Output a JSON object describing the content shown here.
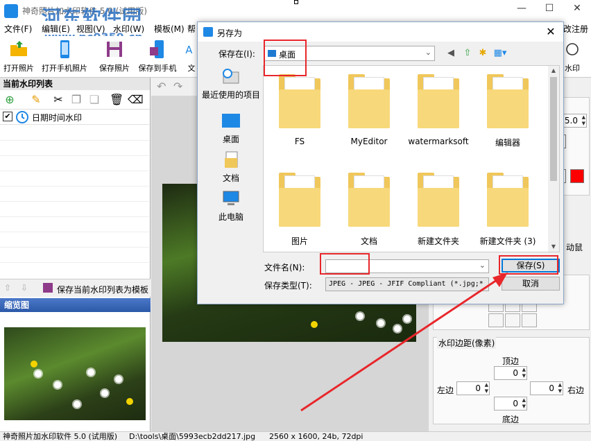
{
  "app": {
    "title": "神奇照片加水印软件 5.0 (试用版)",
    "watermark_brand": "河东软件园",
    "watermark_url": "www.pc0359.cn",
    "register": "改注册码",
    "win_min": "—",
    "win_max": "☐",
    "win_close": "✕"
  },
  "menu": [
    {
      "label": "文件(F)"
    },
    {
      "label": "编辑(E)"
    },
    {
      "label": "视图(V)"
    },
    {
      "label": "水印(W)"
    },
    {
      "label": "模板(M)"
    },
    {
      "label": "帮"
    }
  ],
  "toolbar": [
    {
      "label": "打开照片",
      "icon": "open-folder-icon"
    },
    {
      "label": "打开手机照片",
      "icon": "phone-icon"
    },
    {
      "label": "保存照片",
      "icon": "save-icon"
    },
    {
      "label": "保存到手机",
      "icon": "save-to-phone-icon"
    },
    {
      "label": "文",
      "icon": "text-icon"
    },
    {
      "label": "水印",
      "icon": "watermark-icon"
    }
  ],
  "left_panel": {
    "header": "当前水印列表",
    "item": "日期时间水印",
    "save_template": "保存当前水印列表为模板",
    "thumb_header": "缩览图"
  },
  "right_panel": {
    "version_value": "5.0",
    "drag_hint": "动鼠",
    "margin_title": "水印边距(像素)",
    "top_label": "顶边",
    "left_label": "左边",
    "right_label": "右边",
    "bottom_label": "底边",
    "top_value": "0",
    "left_value": "0",
    "right_value": "0",
    "bottom_value": "0"
  },
  "status": {
    "app": "神奇照片加水印软件 5.0 (试用版)",
    "path": "D:\\tools\\桌面\\5993ecb2dd217.jpg",
    "info": "2560 x 1600, 24b, 72dpi"
  },
  "dialog": {
    "title": "另存为",
    "close": "✕",
    "save_in_label": "保存在(I):",
    "save_in_value": "桌面",
    "places": [
      {
        "label": "最近使用的项目",
        "icon": "recent-icon"
      },
      {
        "label": "桌面",
        "icon": "desktop-icon"
      },
      {
        "label": "文档",
        "icon": "documents-icon"
      },
      {
        "label": "此电脑",
        "icon": "computer-icon"
      }
    ],
    "files": [
      {
        "name": "FS"
      },
      {
        "name": "MyEditor"
      },
      {
        "name": "watermarksoft"
      },
      {
        "name": "编辑器"
      },
      {
        "name": "图片"
      },
      {
        "name": "文档"
      },
      {
        "name": "新建文件夹"
      },
      {
        "name": "新建文件夹 (3)"
      }
    ],
    "file_name_label": "文件名(N):",
    "file_name_value": "",
    "file_type_label": "保存类型(T):",
    "file_type_value": "JPEG - JPEG - JFIF Compliant (*.jpg;*",
    "save_button": "保存(S)",
    "cancel_button": "取消"
  },
  "colors": {
    "accent": "#0078d7",
    "highlight": "#e8262b",
    "folder": "#f0c75a",
    "thumb_header": "#2c58a8"
  }
}
